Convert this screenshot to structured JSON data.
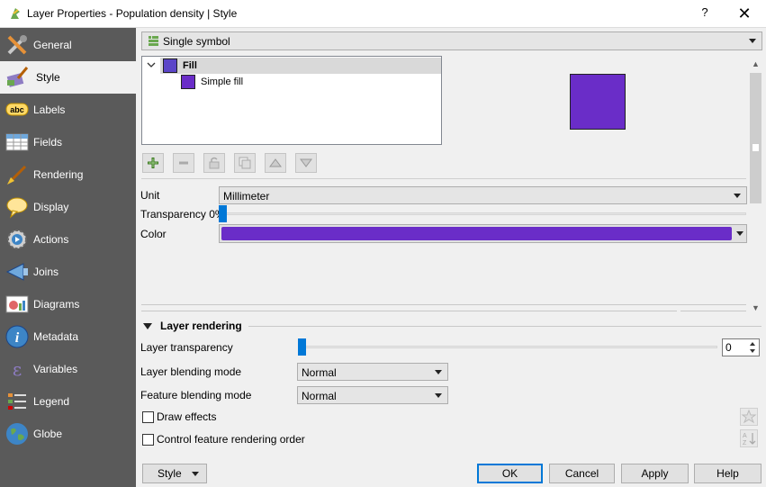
{
  "window": {
    "title": "Layer Properties - Population density | Style",
    "help_glyph": "?",
    "close_glyph": "✕"
  },
  "sidebar": {
    "items": [
      {
        "label": "General",
        "icon": "wrench-screwdriver-icon"
      },
      {
        "label": "Style",
        "icon": "paint-brush-icon",
        "selected": true
      },
      {
        "label": "Labels",
        "icon": "abc-label-icon"
      },
      {
        "label": "Fields",
        "icon": "table-fields-icon"
      },
      {
        "label": "Rendering",
        "icon": "brush-icon"
      },
      {
        "label": "Display",
        "icon": "speech-bubble-icon"
      },
      {
        "label": "Actions",
        "icon": "gear-play-icon"
      },
      {
        "label": "Joins",
        "icon": "join-arrow-icon"
      },
      {
        "label": "Diagrams",
        "icon": "diagram-icon"
      },
      {
        "label": "Metadata",
        "icon": "info-icon"
      },
      {
        "label": "Variables",
        "icon": "epsilon-icon"
      },
      {
        "label": "Legend",
        "icon": "legend-icon"
      },
      {
        "label": "Globe",
        "icon": "globe-icon"
      }
    ]
  },
  "renderer": {
    "selected": "Single symbol"
  },
  "symbol_tree": {
    "root_label": "Fill",
    "root_color": "#5b45c8",
    "child_label": "Simple fill",
    "child_color": "#6a2dc8"
  },
  "preview_color": "#6a2dc8",
  "symbol_toolbar": {
    "buttons": [
      "add-layer-icon",
      "remove-layer-icon",
      "lock-icon",
      "duplicate-icon",
      "move-up-icon",
      "move-down-icon"
    ]
  },
  "symbol_props": {
    "unit_label": "Unit",
    "unit_value": "Millimeter",
    "transparency_label": "Transparency 0%",
    "transparency_fraction": 0,
    "color_label": "Color",
    "color_value": "#6a2dc8"
  },
  "layer_rendering": {
    "section_title": "Layer rendering",
    "transparency_label": "Layer transparency",
    "transparency_value": "0",
    "layer_blend_label": "Layer blending mode",
    "layer_blend_value": "Normal",
    "feature_blend_label": "Feature blending mode",
    "feature_blend_value": "Normal",
    "draw_effects_label": "Draw effects",
    "draw_effects_checked": false,
    "control_order_label": "Control feature rendering order",
    "control_order_checked": false
  },
  "footer": {
    "style_label": "Style",
    "ok_label": "OK",
    "cancel_label": "Cancel",
    "apply_label": "Apply",
    "help_label": "Help"
  },
  "colors": {
    "sidebar_bg": "#5a5a5a",
    "accent": "#0078d7"
  }
}
